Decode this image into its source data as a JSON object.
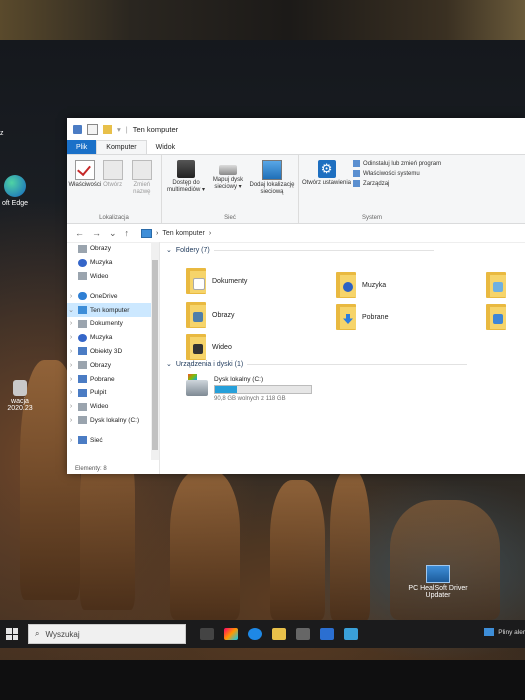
{
  "desktop": {
    "edge_label": "oft Edge",
    "top_label": "z",
    "lock_label": "wacja 2020.23",
    "pc_label": "PC HealSoft Driver Updater"
  },
  "explorer": {
    "title": "Ten komputer",
    "tabs": [
      "Plik",
      "Komputer",
      "Widok"
    ],
    "ribbon": {
      "location_group": {
        "label": "Lokalizacja",
        "buttons": [
          "Właściwości",
          "Otwórz",
          "Zmień nazwę"
        ]
      },
      "network_group": {
        "label": "Sieć",
        "buttons": [
          "Dostęp do multimediów ▾",
          "Mapuj dysk sieciowy ▾",
          "Dodaj lokalizację sieciową"
        ]
      },
      "system_group": {
        "label": "System",
        "open_settings": "Otwórz ustawienia",
        "items": [
          "Odinstaluj lub zmień program",
          "Właściwości systemu",
          "Zarządzaj"
        ]
      }
    },
    "address": {
      "back": "←",
      "forward": "→",
      "recent": "⌄",
      "up": "↑",
      "path": "Ten komputer",
      "sep": "›"
    },
    "nav": [
      {
        "label": "Obrazy",
        "icon": "pictures-icon",
        "pinned": true
      },
      {
        "label": "Muzyka",
        "icon": "music-icon"
      },
      {
        "label": "Wideo",
        "icon": "video-icon"
      },
      {
        "label": "OneDrive",
        "icon": "onedrive-icon",
        "chev": "›"
      },
      {
        "label": "Ten komputer",
        "icon": "pc-icon",
        "chev": "⌄",
        "selected": true
      },
      {
        "label": "Dokumenty",
        "icon": "documents-icon",
        "chev": "›"
      },
      {
        "label": "Muzyka",
        "icon": "music-icon",
        "chev": "›"
      },
      {
        "label": "Obiekty 3D",
        "icon": "objects-3d-icon",
        "chev": "›"
      },
      {
        "label": "Obrazy",
        "icon": "pictures-icon",
        "chev": "›"
      },
      {
        "label": "Pobrane",
        "icon": "downloads-icon",
        "chev": "›"
      },
      {
        "label": "Pulpit",
        "icon": "desktop-icon",
        "chev": "›"
      },
      {
        "label": "Wideo",
        "icon": "video-icon",
        "chev": "›"
      },
      {
        "label": "Dysk lokalny (C:)",
        "icon": "drive-icon",
        "chev": "›"
      },
      {
        "label": "Sieć",
        "icon": "network-icon",
        "chev": "›"
      }
    ],
    "folders_header": "Foldery (7)",
    "folders": [
      {
        "label": "Dokumenty",
        "badge": "doc"
      },
      {
        "label": "Muzyka",
        "badge": "music"
      },
      {
        "label": "",
        "badge": "3d"
      },
      {
        "label": "Obrazy",
        "badge": "img"
      },
      {
        "label": "Pobrane",
        "badge": "down"
      },
      {
        "label": "",
        "badge": "desk"
      },
      {
        "label": "Wideo",
        "badge": "vid"
      }
    ],
    "devices_header": "Urządzenia i dyski (1)",
    "drive": {
      "name": "Dysk lokalny (C:)",
      "free": "90,8 GB wolnych z 118 GB",
      "used_fraction": 0.23
    },
    "status": "Elementy: 8"
  },
  "taskbar": {
    "search_placeholder": "Wyszukaj",
    "tray_text": "Pliny aler"
  }
}
